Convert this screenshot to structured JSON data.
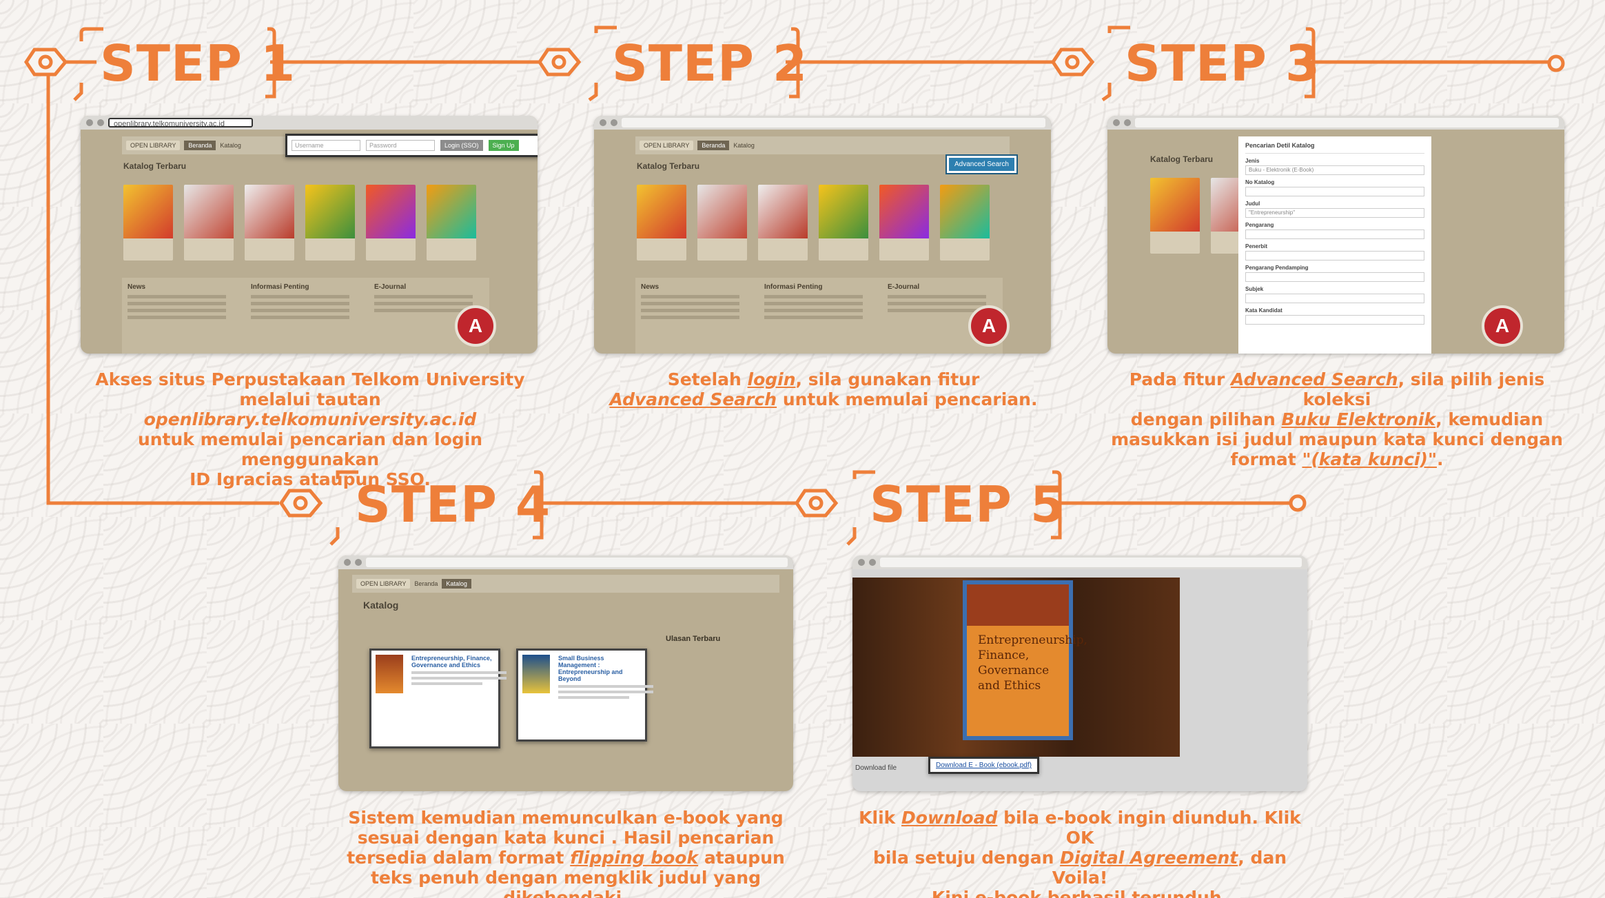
{
  "theme": {
    "accent": "#ee7f3a",
    "background": "#f7f4f1",
    "pattern": "#d8d2cb"
  },
  "steps": [
    {
      "label": "STEP 1",
      "url": "openlibrary.telkomuniversity.ac.id",
      "catalog_title": "Katalog Terbaru",
      "login": {
        "username_placeholder": "Username",
        "password_placeholder": "Password",
        "login_button": "Login (SSO)",
        "signup_button": "Sign Up"
      },
      "sections": [
        "News",
        "Informasi Penting",
        "E-Journal"
      ],
      "description": {
        "l1": "Akses situs Perpustakaan Telkom University",
        "l2a": "melalui tautan ",
        "l2b": "openlibrary.telkomuniversity.ac.id",
        "l3": "untuk memulai pencarian dan login menggunakan",
        "l4": "ID Igracias ataupun SSO."
      }
    },
    {
      "label": "STEP 2",
      "catalog_title": "Katalog Terbaru",
      "advanced_search_button": "Advanced Search",
      "sections": [
        "News",
        "Informasi Penting",
        "E-Journal"
      ],
      "description": {
        "l1a": "Setelah ",
        "l1b": "login",
        "l1c": ", sila gunakan fitur",
        "l2a": "Advanced Search",
        "l2b": " untuk memulai pencarian."
      }
    },
    {
      "label": "STEP 3",
      "catalog_title": "Katalog Terbaru",
      "modal_title": "Pencarian Detil Katalog",
      "modal_fields": [
        "Jenis",
        "No Katalog",
        "Judul",
        "Pengarang",
        "Penerbit",
        "Pengarang Pendamping",
        "Subjek",
        "Kata Kandidat"
      ],
      "description": {
        "l1a": "Pada fitur ",
        "l1b": "Advanced Search",
        "l1c": ", sila pilih jenis koleksi",
        "l2a": "dengan pilihan ",
        "l2b": "Buku Elektronik",
        "l2c": ", kemudian",
        "l3": "masukkan isi judul maupun kata kunci dengan",
        "l4a": "format ",
        "l4b": "\"(kata kunci)\"",
        "l4c": "."
      }
    },
    {
      "label": "STEP 4",
      "catalog_title": "Katalog",
      "results": [
        "Entrepreneurship, Finance, Governance and Ethics",
        "Small Business Management : Entrepreneurship and Beyond"
      ],
      "sidebar_title": "Ulasan Terbaru",
      "description": {
        "l1": "Sistem kemudian memunculkan e-book yang",
        "l2": "sesuai dengan kata kunci . Hasil pencarian",
        "l3a": "tersedia dalam format ",
        "l3b": "flipping book",
        "l3c": " ataupun",
        "l4": "teks penuh dengan mengklik judul yang dikehendaki."
      }
    },
    {
      "label": "STEP 5",
      "ebook_title": "Entrepreneurship, Finance, Governance and Ethics",
      "download_label": "Download file",
      "download_link": "Download E - Book (ebook.pdf)",
      "description": {
        "l1a": "Klik ",
        "l1b": "Download",
        "l1c": " bila e-book ingin diunduh. Klik OK",
        "l2a": "bila setuju dengan ",
        "l2b": "Digital Agreement",
        "l2c": ", dan Voila!",
        "l3": "Kini e-book berhasil terunduh."
      }
    }
  ]
}
